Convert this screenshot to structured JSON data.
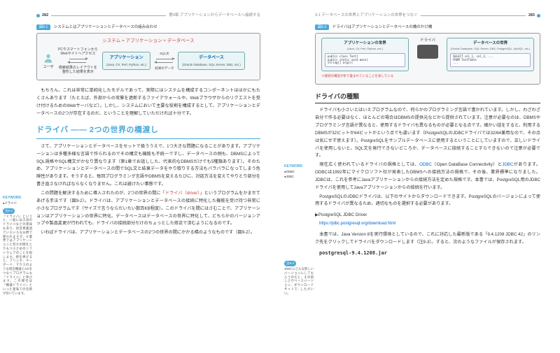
{
  "left": {
    "page_num": "282",
    "chapter": "第9章 アプリケーションからデータベースへ接続する",
    "fig1": {
      "label": "図9-1",
      "title": "システムとはアプリケーションとデータベースの組み合わせ",
      "sys": "システム = アプリケーション + データベース",
      "pc": "PCやスマートフォンから\nWebサイトへアクセス",
      "user": "ユーザ",
      "layout": "検索結果のレイアウトを\n整形した結果を表示",
      "app_t": "アプリケーション",
      "app_s": "(Java, C#, Perl, Python, etc.)",
      "sql": "SQL文",
      "res": "結果のデータ",
      "db_t": "データベース",
      "db_s": "(Oracle Database, SQL Server, DB2, etc.)"
    },
    "p1": "もちろん、これは非常に単純化したモデルであって、実際にはシステムを構成するコンポーネントはほかにもたくさんあります（たとえば、外部からの攻撃を遮断するファイアウォールや、Webブラウザからのリクエストを受け付けるためのWebサーバなど）。しかし、システムにおいて主要な役割を構成するとして、アプリケーションとデータベースの2つが存在するのだ、ということを理解していただければ十分です。",
    "h2": "ドライバ —— 2つの世界の橋渡し",
    "p2": "さて、アプリケーションとデータベースをセットで扱ううえで、1つ大きな問題になることがあります。アプリケーションは多種多様な言語で作られるのでその構文も機能も不統一ですし、データベースの側も、DBMSによってSQL規格やSQL構文がかなり異なります（第1章でお話しした、代表的なDBMSだけでも5種類あります）。そのため、アプリケーションとデータベースの間でSQL文と結果データをやり取りする方法もバラバラになってしまう危険性があります。そうすると、毎回プログラミング言語やDBMSを変えるたびに、対話方法を変えてやりとり部分を書き直さなければならなくなりません。これは避けたい事態です。",
    "p3": "この問題を解決するために導入されたのが、2つの世界の間に「",
    "kwd1": "ドライバ（driver）",
    "p3b": "」というプログラムをかませてあげる手法です（",
    "ref1": "図9-2",
    "p3c": "）。ドライバは、アプリケーションとデータベースの接続に特化した機能を受け持つ非常に小さなプログラムです（サイズで言うならだいたい数百KB程度）。このドライバを間にはさむことで、アプリケーションはアプリケーションの世界に特化、データベースはデータベースの世界に特化して、どちらかのバージョンアップや製品変更が行われても、ドライバの接続部分だけのちょっとした修正で済むようになるのです。",
    "p4": "いわばドライバは、アプリケーションとデータベースの2つの世界の間にかかる橋のようなものです（",
    "ref2": "図9-2",
    "p4b": "）。",
    "kw_h": "KEYWORD",
    "kw1": "●ドライバ",
    "note_h": "注9-2",
    "note_b": "「ドライバ」というと、一般には工具のドライバなどの意味もあり、同音異義語でいろいろな分野で使われますが、IT業界ではアプリケーションと何かの間をとりもつ小さめのソフトウェアのことを指します。例を挙げると、プリンタ、キーボード、マウスのような周辺機器とOSをつなぐプログラムも「ドライバ」と呼びます。この場合は「機器ドライバ」といった意味での名称が付いています。"
  },
  "right": {
    "page_num": "283",
    "chapter": "9-1 データベースの世界とアプリケーションの世界をつなぐ",
    "fig2": {
      "label": "図9-2",
      "title": "ドライバはアプリケーションとデータベースの橋のかけ橋",
      "app_t": "アプリケーションの世界",
      "app_s": "(Java, C#, Perl, Python, etc.)",
      "code": "public class Test{\npublic static void main(\nstring[] args){",
      "drv": "ドライバ",
      "db_t": "データベースの世界",
      "db_s": "(Oracle Database, SQL Server, DB2, PostgreSQL, MySQL, etc.)",
      "sql": "SELECT col_1, col_2, ...\nFROM TestTable\n...",
      "foot": "※接続の構造が折り畳まれていることを表している"
    },
    "h3": "ドライバの種類",
    "p1": "ドライバも小さいとはいえプログラムなので、何らかのプログラミング言語で書かれています。しかし、わざわざ自分で作る必要はなく、ほとんどの場合はDBMSの提供元などから提供されています。注意が必要なのは、DBMSやプログラミング言語が異なると、使用するドライバも異なるものが必要となる点です。細かい話をすると、利用するDBMSが32ビットか64ビットかという点でも違います（PostgreSQLのJDBCドライバでは32/64兼用なので、その点は気にせず使えます）。PostgreSQLをサンプルデータベースに使用するということにしていますので、正しいドライバを使用しないと、SQL文を発行できないどころか、データベースに接続することすらできないので注意が必要です。",
    "p2a": "現在広く使われているドライバの規格としては、",
    "l1": "ODBC",
    "p2b": "（Open DataBase Connectivity）と",
    "l2": "JDBC",
    "p2c": "があります。ODBCは1992年にマイクロソフト社が発表したDBMSへの接続方法の規格で、その後、業界標準になりました。JDBCは、これを参考にJavaアプリケーションからの接続方法を定めた規格です。本書では、PostgreSQL用のJDBCドライバを使用してJavaアプリケーションからの接続を行います。",
    "p3": "PostgreSQLのJDBCドライバは、以下のサイトからダウンロードできます。PostgreSQLのバージョンによって使用するドライバが異なるため、適切なものを選択する必要があります。",
    "dl_h": "▶PostgreSQL JDBC Driver",
    "dl_u": "https://jdbc.postgresql.org/download.html",
    "p4a": "本書では、Java Version 8を実行環境としているので、これに対応した最新版である「9.4.1208 JDBC 42」のリンク先をクリックしてドライバをダウンロードします（",
    "ref": "注9-3",
    "p4b": "）。すると、次のようなファイルが保存されます。",
    "jar": "postgresql-9.4.1208.jar",
    "kw_h": "KEYWORD",
    "kw1": "●ODBC",
    "kw2": "●JDBC",
    "note_h": "注9-3",
    "note_b": "JDBCにどんな新しいバージョンにしてもらうのだと、その新しさがベースバージョン、ダウンロードサイトで...したがいい。"
  }
}
